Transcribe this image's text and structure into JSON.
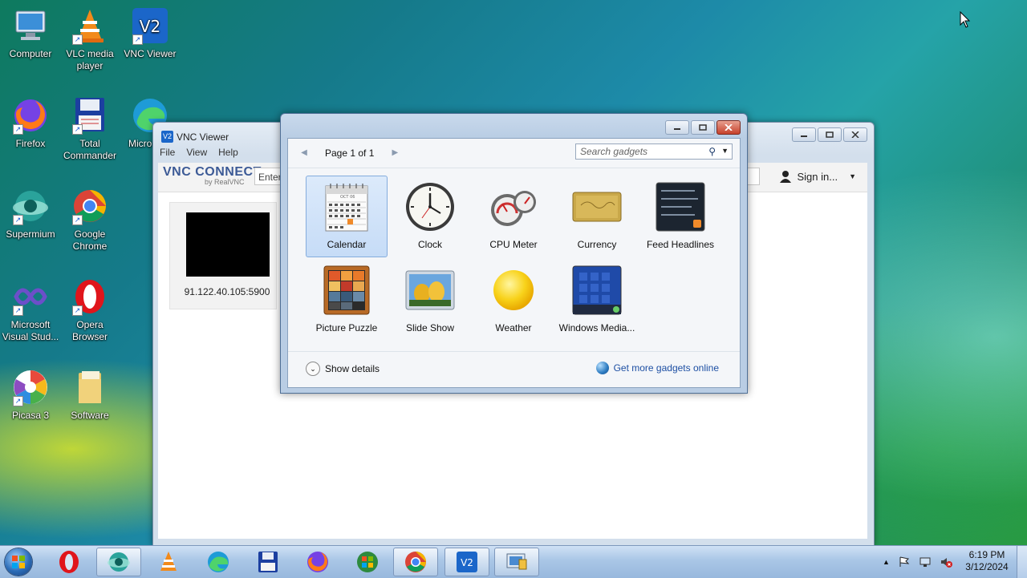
{
  "desktop": {
    "icons": [
      {
        "label": "Computer",
        "icon": "computer-icon"
      },
      {
        "label": "VLC media player",
        "icon": "vlc-icon"
      },
      {
        "label": "VNC Viewer",
        "icon": "vnc-viewer-icon"
      },
      {
        "label": "Firefox",
        "icon": "firefox-icon"
      },
      {
        "label": "Total Commander",
        "icon": "total-commander-icon"
      },
      {
        "label": "Micro Edg",
        "icon": "edge-icon"
      },
      {
        "label": "Supermium",
        "icon": "supermium-icon"
      },
      {
        "label": "Google Chrome",
        "icon": "chrome-icon"
      },
      {
        "label": "Microsoft Visual Stud...",
        "icon": "visual-studio-icon"
      },
      {
        "label": "Opera Browser",
        "icon": "opera-icon"
      },
      {
        "label": "Picasa 3",
        "icon": "picasa-icon"
      },
      {
        "label": "Software",
        "icon": "folder-icon"
      }
    ]
  },
  "vnc_window": {
    "title": "VNC Viewer",
    "menu": [
      "File",
      "View",
      "Help"
    ],
    "brand": "VNC CONNECT",
    "brand_sub": "by RealVNC",
    "address_placeholder": "Enter",
    "sign_in": "Sign in...",
    "connection": {
      "label": "91.122.40.105:5900"
    }
  },
  "gadgets_window": {
    "page_indicator": "Page 1 of 1",
    "search_placeholder": "Search gadgets",
    "gadgets": [
      {
        "label": "Calendar",
        "selected": true
      },
      {
        "label": "Clock",
        "selected": false
      },
      {
        "label": "CPU Meter",
        "selected": false
      },
      {
        "label": "Currency",
        "selected": false
      },
      {
        "label": "Feed Headlines",
        "selected": false
      },
      {
        "label": "Picture Puzzle",
        "selected": false
      },
      {
        "label": "Slide Show",
        "selected": false
      },
      {
        "label": "Weather",
        "selected": false
      },
      {
        "label": "Windows Media...",
        "selected": false
      }
    ],
    "show_details": "Show details",
    "get_more": "Get more gadgets online"
  },
  "taskbar": {
    "items": [
      "opera-icon",
      "supermium-icon",
      "vlc-icon",
      "edge-icon",
      "total-commander-icon",
      "firefox-icon",
      "windows-logo-icon",
      "chrome-icon",
      "vnc-viewer-icon",
      "gadgets-icon"
    ],
    "time": "6:19 PM",
    "date": "3/12/2024"
  }
}
